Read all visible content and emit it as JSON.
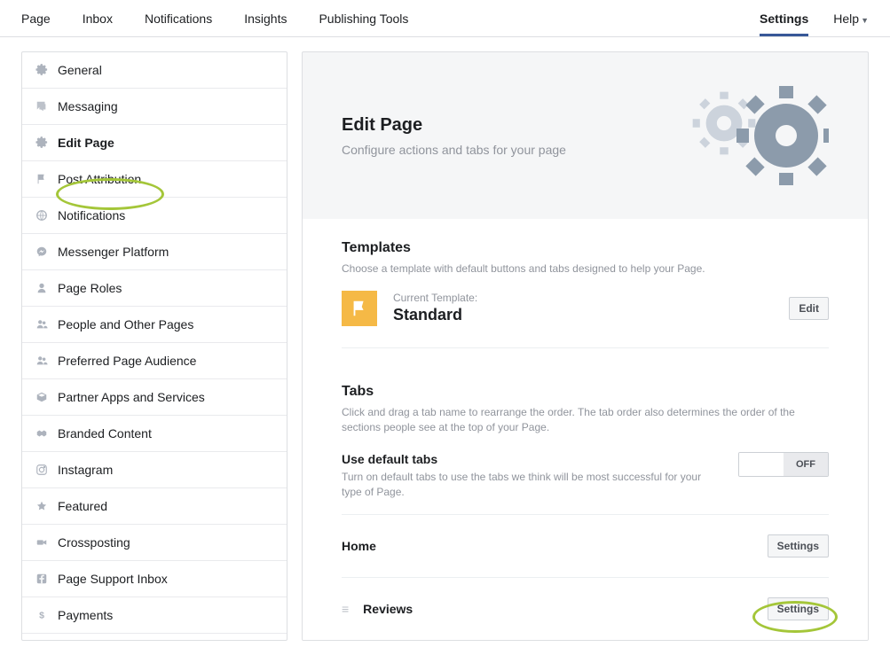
{
  "topnav": {
    "left": [
      "Page",
      "Inbox",
      "Notifications",
      "Insights",
      "Publishing Tools"
    ],
    "settings": "Settings",
    "help": "Help"
  },
  "sidebar": [
    {
      "label": "General",
      "icon": "gear"
    },
    {
      "label": "Messaging",
      "icon": "chat"
    },
    {
      "label": "Edit Page",
      "icon": "gear",
      "active": true
    },
    {
      "label": "Post Attribution",
      "icon": "flag"
    },
    {
      "label": "Notifications",
      "icon": "globe"
    },
    {
      "label": "Messenger Platform",
      "icon": "messenger"
    },
    {
      "label": "Page Roles",
      "icon": "person"
    },
    {
      "label": "People and Other Pages",
      "icon": "people"
    },
    {
      "label": "Preferred Page Audience",
      "icon": "people"
    },
    {
      "label": "Partner Apps and Services",
      "icon": "box"
    },
    {
      "label": "Branded Content",
      "icon": "handshake"
    },
    {
      "label": "Instagram",
      "icon": "instagram"
    },
    {
      "label": "Featured",
      "icon": "star"
    },
    {
      "label": "Crossposting",
      "icon": "camcorder"
    },
    {
      "label": "Page Support Inbox",
      "icon": "facebook"
    },
    {
      "label": "Payments",
      "icon": "dollar"
    }
  ],
  "header": {
    "title": "Edit Page",
    "subtitle": "Configure actions and tabs for your page"
  },
  "templates": {
    "title": "Templates",
    "desc": "Choose a template with default buttons and tabs designed to help your Page.",
    "current_label": "Current Template:",
    "current_name": "Standard",
    "edit_btn": "Edit"
  },
  "tabs": {
    "title": "Tabs",
    "desc": "Click and drag a tab name to rearrange the order. The tab order also determines the order of the sections people see at the top of your Page.",
    "default_title": "Use default tabs",
    "default_desc": "Turn on default tabs to use the tabs we think will be most successful for your type of Page.",
    "toggle_state": "OFF",
    "rows": [
      {
        "name": "Home",
        "btn": "Settings",
        "drag": false
      },
      {
        "name": "Reviews",
        "btn": "Settings",
        "drag": true
      }
    ]
  }
}
